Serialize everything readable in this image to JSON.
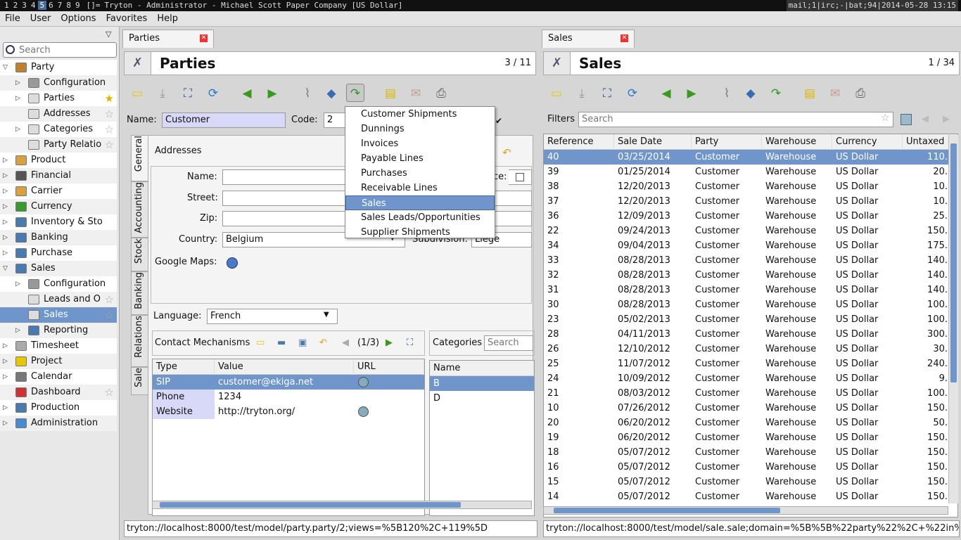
{
  "wm": {
    "workspaces": [
      "1",
      "2",
      "3",
      "4",
      "5",
      "6",
      "7",
      "8",
      "9"
    ],
    "layout": "[]=",
    "window_title": "Tryton - Administrator - Michael Scott Paper Company [US Dollar]",
    "status": "mail;1|irc;-|bat;94|2014-05-28 13:15"
  },
  "menu": {
    "file": "File",
    "user": "User",
    "options": "Options",
    "favorites": "Favorites",
    "help": "Help"
  },
  "sidebar": {
    "search_placeholder": "Search",
    "items": [
      {
        "label": "Party",
        "tw": "▽",
        "indent": 0
      },
      {
        "label": "Configuration",
        "tw": "▷",
        "indent": 1
      },
      {
        "label": "Parties",
        "tw": "▷",
        "indent": 1,
        "star": "on"
      },
      {
        "label": "Addresses",
        "tw": "",
        "indent": 1,
        "star": "off"
      },
      {
        "label": "Categories",
        "tw": "▷",
        "indent": 1,
        "star": "off"
      },
      {
        "label": "Party Relatio",
        "tw": "",
        "indent": 1,
        "star": "off"
      },
      {
        "label": "Product",
        "tw": "▷",
        "indent": 0
      },
      {
        "label": "Financial",
        "tw": "▷",
        "indent": 0
      },
      {
        "label": "Carrier",
        "tw": "▷",
        "indent": 0
      },
      {
        "label": "Currency",
        "tw": "▷",
        "indent": 0
      },
      {
        "label": "Inventory & Sto",
        "tw": "▷",
        "indent": 0
      },
      {
        "label": "Banking",
        "tw": "▷",
        "indent": 0
      },
      {
        "label": "Purchase",
        "tw": "▷",
        "indent": 0
      },
      {
        "label": "Sales",
        "tw": "▽",
        "indent": 0
      },
      {
        "label": "Configuration",
        "tw": "▷",
        "indent": 1
      },
      {
        "label": "Leads and O",
        "tw": "",
        "indent": 1,
        "star": "off"
      },
      {
        "label": "Sales",
        "tw": "",
        "indent": 1,
        "star": "off",
        "sel": true
      },
      {
        "label": "Reporting",
        "tw": "▷",
        "indent": 1
      },
      {
        "label": "Timesheet",
        "tw": "▷",
        "indent": 0
      },
      {
        "label": "Project",
        "tw": "▷",
        "indent": 0
      },
      {
        "label": "Calendar",
        "tw": "▷",
        "indent": 0
      },
      {
        "label": "Dashboard",
        "tw": "",
        "indent": 0,
        "star": "off"
      },
      {
        "label": "Production",
        "tw": "▷",
        "indent": 0
      },
      {
        "label": "Administration",
        "tw": "▷",
        "indent": 0
      }
    ]
  },
  "parties": {
    "tab": "Parties",
    "title": "Parties",
    "count": "3 / 11",
    "name_label": "Name:",
    "name_value": "Customer",
    "code_label": "Code:",
    "code_value": "2",
    "vtabs": [
      "General",
      "Accounting",
      "Stock",
      "Banking",
      "Relations",
      "Sale"
    ],
    "addresses_label": "Addresses",
    "addr": {
      "name_label": "Name:",
      "street_label": "Street:",
      "zip_label": "Zip:",
      "zip_tail": "e",
      "country_label": "Country:",
      "country_value": "Belgium",
      "subdivision_label": "Subdivision:",
      "subdivision_value": "Liege",
      "maps_label": "Google Maps:",
      "invoice_tail": "ce:"
    },
    "language_label": "Language:",
    "language_value": "French",
    "contact_label": "Contact Mechanisms",
    "contact_page": "(1/3)",
    "contact_cols": [
      "Type",
      "Value",
      "URL"
    ],
    "contacts": [
      {
        "type": "SIP",
        "value": "customer@ekiga.net",
        "url": true
      },
      {
        "type": "Phone",
        "value": "1234",
        "url": false
      },
      {
        "type": "Website",
        "value": "http://tryton.org/",
        "url": true
      }
    ],
    "categories_label": "Categories",
    "categories_search": "Search",
    "cat_col": "Name",
    "categories": [
      "B",
      "D"
    ],
    "url": "tryton://localhost:8000/test/model/party.party/2;views=%5B120%2C+119%5D"
  },
  "relate_menu": [
    "Customer Shipments",
    "Dunnings",
    "Invoices",
    "Payable Lines",
    "Purchases",
    "Receivable Lines",
    "Sales",
    "Sales Leads/Opportunities",
    "Supplier Shipments"
  ],
  "relate_selected": "Sales",
  "sales": {
    "tab": "Sales",
    "title": "Sales",
    "count": "1 / 34",
    "filters_label": "Filters",
    "search_placeholder": "Search",
    "cols": [
      "Reference",
      "Sale Date",
      "Party",
      "Warehouse",
      "Currency",
      "Untaxed"
    ],
    "rows": [
      [
        "40",
        "03/25/2014",
        "110."
      ],
      [
        "39",
        "01/25/2014",
        "20."
      ],
      [
        "38",
        "12/20/2013",
        "10."
      ],
      [
        "37",
        "12/20/2013",
        "10."
      ],
      [
        "36",
        "12/09/2013",
        "25."
      ],
      [
        "22",
        "09/24/2013",
        "150."
      ],
      [
        "34",
        "09/04/2013",
        "175."
      ],
      [
        "33",
        "08/28/2013",
        "140."
      ],
      [
        "32",
        "08/28/2013",
        "140."
      ],
      [
        "31",
        "08/28/2013",
        "140."
      ],
      [
        "30",
        "08/28/2013",
        "100."
      ],
      [
        "23",
        "05/02/2013",
        "100."
      ],
      [
        "28",
        "04/11/2013",
        "300."
      ],
      [
        "26",
        "12/10/2012",
        "30."
      ],
      [
        "25",
        "11/07/2012",
        "240."
      ],
      [
        "24",
        "10/09/2012",
        "9."
      ],
      [
        "21",
        "08/03/2012",
        "100."
      ],
      [
        "10",
        "07/26/2012",
        "150."
      ],
      [
        "20",
        "06/20/2012",
        "50."
      ],
      [
        "19",
        "06/20/2012",
        "150."
      ],
      [
        "18",
        "05/07/2012",
        "150."
      ],
      [
        "16",
        "05/07/2012",
        "150."
      ],
      [
        "15",
        "05/07/2012",
        "150."
      ],
      [
        "14",
        "05/07/2012",
        "150."
      ]
    ],
    "party": "Customer",
    "warehouse": "Warehouse",
    "currency": "US Dollar",
    "url": "tryton://localhost:8000/test/model/sale.sale;domain=%5B%5B%22party%22%2C+%22in%"
  }
}
